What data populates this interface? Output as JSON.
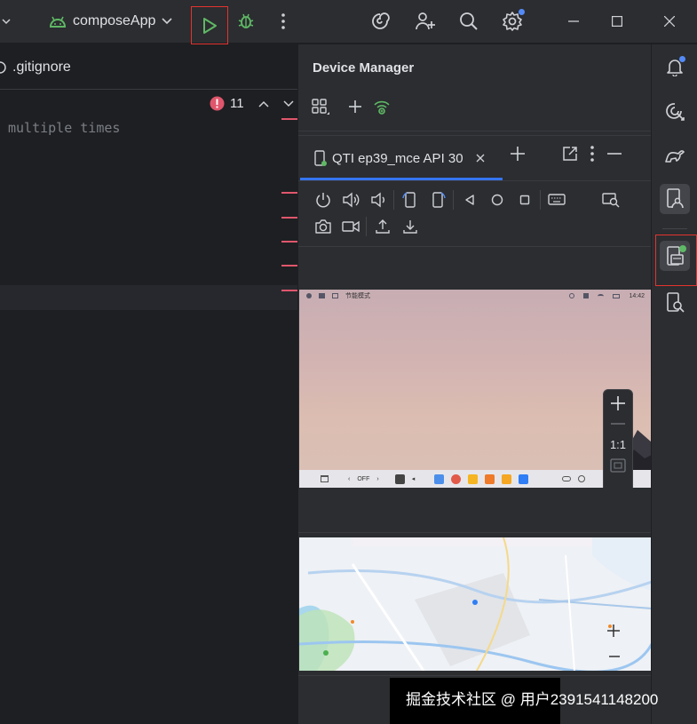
{
  "toolbar": {
    "run_config_label": "composeApp",
    "icons": [
      "chevron-down-icon",
      "android-icon",
      "run-icon",
      "debug-icon",
      "more-icon",
      "ai-assistant-icon",
      "add-user-icon",
      "search-icon",
      "settings-icon",
      "minimize-icon",
      "maximize-icon",
      "close-icon"
    ]
  },
  "editor": {
    "tab_label": ".gitignore",
    "problems_count": "11",
    "code_text": "multiple times"
  },
  "device_manager": {
    "title": "Device Manager",
    "device_tab_label": "QTI ep39_mce API 30",
    "status_text": "节能模式",
    "time": "14:42",
    "taskbar_mode": "OFF",
    "zoom_label": "1:1",
    "controls_row1": [
      "power-icon",
      "volume-up-icon",
      "volume-down-icon",
      "rotate-left-icon",
      "rotate-right-icon",
      "back-icon",
      "home-icon",
      "overview-icon",
      "keyboard-icon",
      "screen-inspect-icon"
    ],
    "controls_row2": [
      "camera-icon",
      "record-icon",
      "upload-icon",
      "download-icon"
    ]
  },
  "colors": {
    "bg": "#1e1f22",
    "panel": "#2b2d30",
    "accent": "#3574f0",
    "run_green": "#5fb865",
    "highlight_red": "#e5332f",
    "error_red": "#e0566c"
  },
  "watermark": "掘金技术社区 @ 用户2391541148200"
}
